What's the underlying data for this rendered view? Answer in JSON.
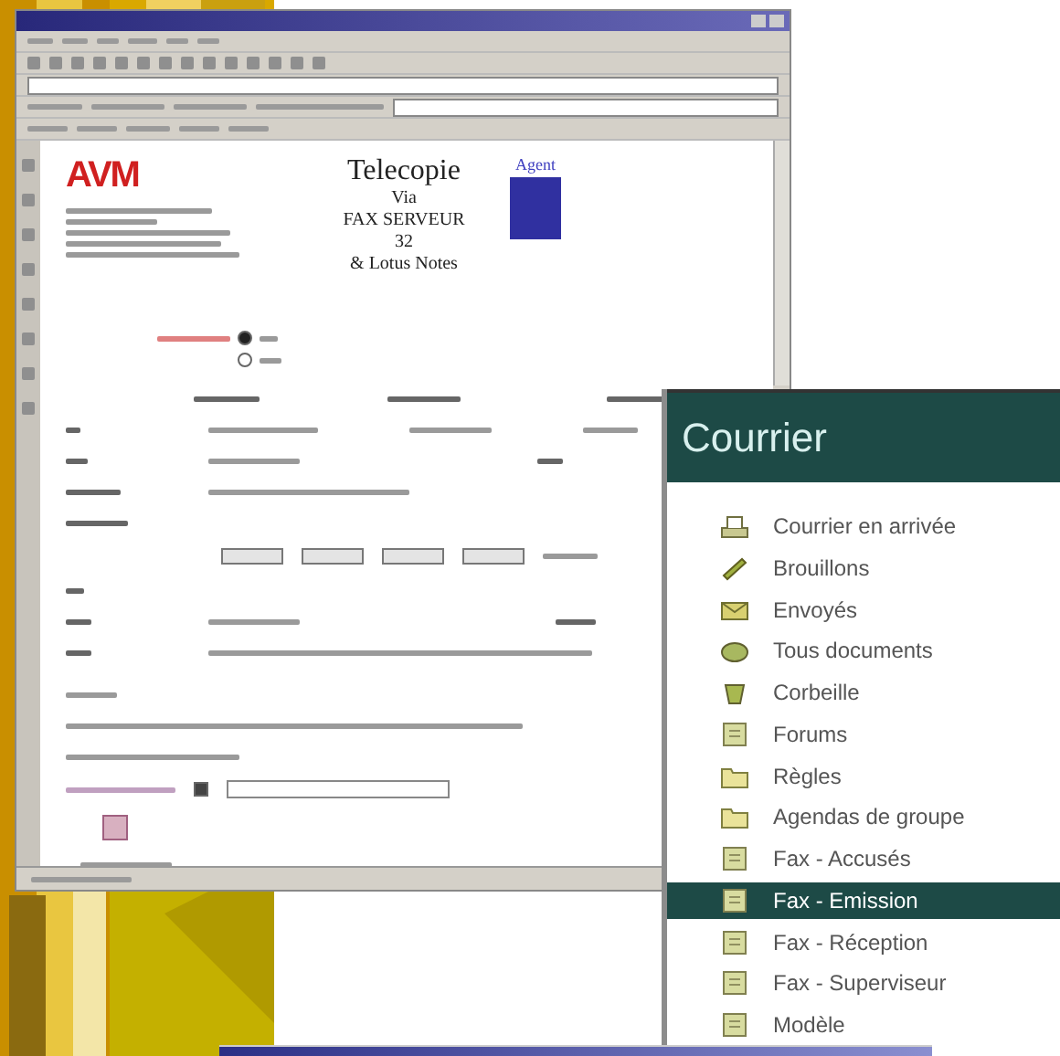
{
  "fax_window": {
    "logo": "AVM",
    "title_lines": [
      "Telecopie",
      "Via",
      "FAX SERVEUR",
      "32",
      "& Lotus Notes"
    ],
    "badge_label": "Agent",
    "attachment_checkbox": {
      "checked": true
    },
    "urgency_options": [
      {
        "selected": true
      },
      {
        "selected": false
      }
    ]
  },
  "mail_panel": {
    "title": "Courrier",
    "folders": [
      {
        "label": "Courrier en arrivée",
        "kind": "tray",
        "selected": false
      },
      {
        "label": "Brouillons",
        "kind": "pen",
        "selected": false
      },
      {
        "label": "Envoyés",
        "kind": "envelope",
        "selected": false
      },
      {
        "label": "Tous documents",
        "kind": "stack",
        "selected": false
      },
      {
        "label": "Corbeille",
        "kind": "bin",
        "selected": false
      },
      {
        "label": "Forums",
        "kind": "doc",
        "selected": false
      },
      {
        "label": "Règles",
        "kind": "folder",
        "selected": false
      },
      {
        "label": "Agendas de groupe",
        "kind": "folder",
        "selected": false
      },
      {
        "label": "Fax - Accusés",
        "kind": "doc",
        "selected": false
      },
      {
        "label": "Fax - Emission",
        "kind": "doc",
        "selected": true
      },
      {
        "label": "Fax - Réception",
        "kind": "doc",
        "selected": false
      },
      {
        "label": "Fax - Superviseur",
        "kind": "doc",
        "selected": false
      },
      {
        "label": "Modèle",
        "kind": "doc",
        "selected": false
      }
    ]
  }
}
